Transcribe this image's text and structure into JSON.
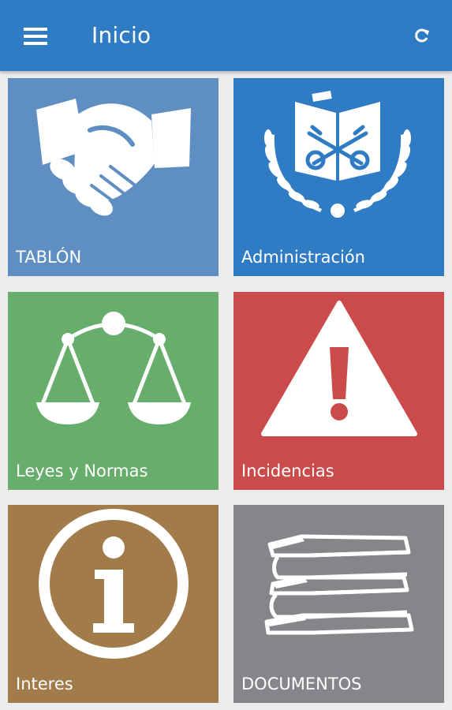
{
  "appbar": {
    "title": "Inicio",
    "color": "#2f7bc4"
  },
  "tiles": [
    {
      "label": "TABLÓN",
      "color": "#5f8fc2",
      "icon": "handshake-icon"
    },
    {
      "label": "Administración",
      "color": "#2f7bc4",
      "icon": "keys-book-icon"
    },
    {
      "label": "Leyes y Normas",
      "color": "#67ad6b",
      "icon": "scales-icon"
    },
    {
      "label": "Incidencias",
      "color": "#cb4b4b",
      "icon": "warning-icon"
    },
    {
      "label": "Interes",
      "color": "#a17c4a",
      "icon": "info-icon"
    },
    {
      "label": "DOCUMENTOS",
      "color": "#85858a",
      "icon": "books-icon"
    }
  ]
}
